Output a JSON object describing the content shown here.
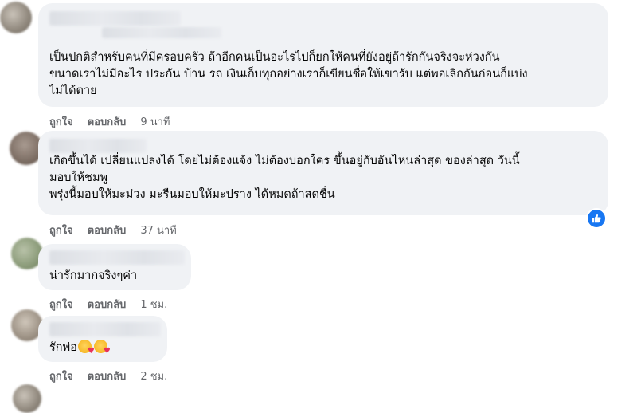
{
  "comments": [
    {
      "text": "เป็นปกติสำหรับคนที่มีครอบครัว ถ้าอีกคนเป็นอะไรไปก็ยกให้คนที่ยังอยู่ถ้ารักกันจริงจะห่วงกัน\nขนาดเราไม่มีอะไร ประกัน บ้าน รถ เงินเก็บทุกอย่างเราก็เขียนชื่อให้เขารับ แต่พอเลิกกันก่อนก็แบ่ง\nไม่ได้ตาย",
      "like": "ถูกใจ",
      "reply": "ตอบกลับ",
      "time": "9 นาที"
    },
    {
      "text": "เกิดขึ้นได้ เปลี่ยนแปลงได้ โดยไม่ต้องแจ้ง ไม่ต้องบอกใคร ขึ้นอยู่กับอันไหนล่าสุด ของล่าสุด วันนี้\nมอบให้ชมพู\nพรุ่งนี้มอบให้มะม่วง มะรืนมอบให้มะปราง ได้หมดถ้าสดชื่น",
      "like": "ถูกใจ",
      "reply": "ตอบกลับ",
      "time": "37 นาที",
      "reaction": "like-reaction-icon"
    },
    {
      "text": "น่ารักมากจริงๆค่า",
      "like": "ถูกใจ",
      "reply": "ตอบกลับ",
      "time": "1 ชม."
    },
    {
      "text": "รักพ่อ",
      "emoji": [
        "smiling-face-with-hearts-icon",
        "smiling-face-with-hearts-icon"
      ],
      "like": "ถูกใจ",
      "reply": "ตอบกลับ",
      "time": "2 ชม."
    }
  ],
  "colors": {
    "bubble": "#f0f2f5",
    "meta": "#65676b",
    "reaction_blue": "#1877f2"
  }
}
